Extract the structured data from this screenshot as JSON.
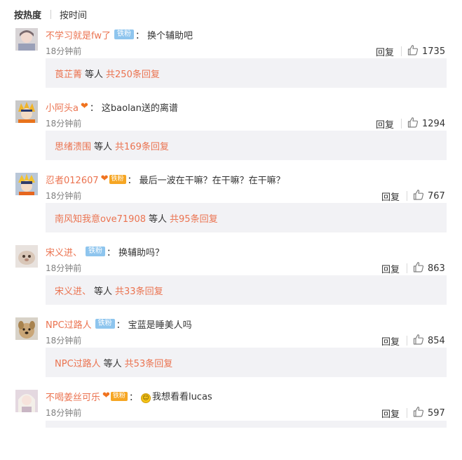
{
  "sort": {
    "hot_label": "按热度",
    "time_label": "按时间"
  },
  "colors": {
    "accent": "#eb7350",
    "fan_badge": "#8ec5ee",
    "super_badge": "#f6a623",
    "reply_bg": "#f2f2f5"
  },
  "badge_text": {
    "fan": "铁粉",
    "super": "铁粉"
  },
  "reply_label": "回复",
  "colon": "：",
  "comments": [
    {
      "username": "不学习就是fw了",
      "badge": "fan",
      "text": "换个辅助吧",
      "emoji": "",
      "time": "18分钟前",
      "likes": "1735",
      "reply_user": "莨芷菁",
      "reply_others": "等人",
      "reply_total": "共250条回复"
    },
    {
      "username": "小阿头a",
      "badge": "heart",
      "text": "这baolan送的离谱",
      "emoji": "",
      "time": "18分钟前",
      "likes": "1294",
      "reply_user": "思绪溃围",
      "reply_others": "等人",
      "reply_total": "共169条回复"
    },
    {
      "username": "忍者012607",
      "badge": "super",
      "text": "最后一波在干嘛？在干嘛？在干嘛？",
      "emoji": "",
      "time": "18分钟前",
      "likes": "767",
      "reply_user": "南风知我意ove71908",
      "reply_others": "等人",
      "reply_total": "共95条回复"
    },
    {
      "username": "宋义进、",
      "badge": "fan",
      "text": "换辅助吗？",
      "emoji": "",
      "time": "18分钟前",
      "likes": "863",
      "reply_user": "宋义进、",
      "reply_others": "等人",
      "reply_total": "共33条回复"
    },
    {
      "username": "NPC过路人",
      "badge": "fan",
      "text": "宝蓝是睡美人吗",
      "emoji": "",
      "time": "18分钟前",
      "likes": "854",
      "reply_user": "NPC过路人",
      "reply_others": "等人",
      "reply_total": "共53条回复"
    },
    {
      "username": "不喝姜丝可乐",
      "badge": "super",
      "text": "我想看看lucas",
      "emoji": "grin-emoji",
      "time": "18分钟前",
      "likes": "597",
      "reply_user": "",
      "reply_others": "",
      "reply_total": ""
    }
  ]
}
